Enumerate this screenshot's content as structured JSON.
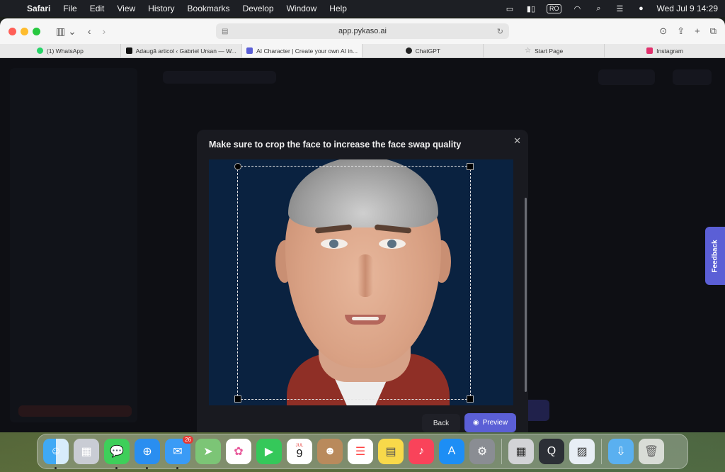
{
  "menubar": {
    "items": [
      "Safari",
      "File",
      "Edit",
      "View",
      "History",
      "Bookmarks",
      "Develop",
      "Window",
      "Help"
    ],
    "input_source": "RO",
    "clock": "Wed Jul 9  14:29"
  },
  "browser": {
    "url": "app.pykaso.ai",
    "tabs": [
      {
        "label": "(1) WhatsApp",
        "color": "#25d366"
      },
      {
        "label": "Adaugă articol ‹ Gabriel Ursan — W...",
        "color": "#111111"
      },
      {
        "label": "AI Character | Create your own AI in...",
        "color": "#5b5fd6"
      },
      {
        "label": "ChatGPT",
        "color": "#222222"
      },
      {
        "label": "Start Page",
        "color": "#888888"
      },
      {
        "label": "Instagram",
        "color": "#e1306c"
      }
    ]
  },
  "modal": {
    "title": "Make sure to crop the face to increase the face swap quality",
    "back_label": "Back",
    "preview_label": "Preview"
  },
  "feedback": {
    "label": "Feedback"
  },
  "dock": {
    "calendar_month": "JUL",
    "calendar_day": "9",
    "mail_badge": "26"
  }
}
